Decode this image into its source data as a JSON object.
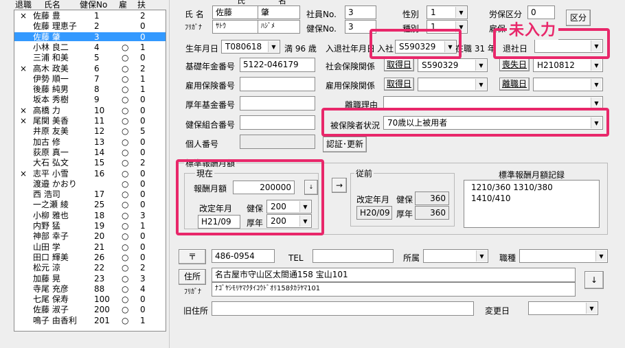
{
  "list": {
    "headers": {
      "retire": "退職",
      "name": "氏名",
      "kenpo_no": "健保No",
      "employment": "雇",
      "dependents": "扶"
    },
    "rows": [
      {
        "retire": "×",
        "name": "佐藤 豊",
        "no": "1",
        "emp": "",
        "dep": "2"
      },
      {
        "retire": "",
        "name": "佐藤 理恵子",
        "no": "2",
        "emp": "",
        "dep": "0"
      },
      {
        "retire": "",
        "name": "佐藤 肇",
        "no": "3",
        "emp": "",
        "dep": "0",
        "selected": true
      },
      {
        "retire": "",
        "name": "小林 良二",
        "no": "4",
        "emp": "○",
        "dep": "1"
      },
      {
        "retire": "",
        "name": "三浦 和美",
        "no": "5",
        "emp": "○",
        "dep": "0"
      },
      {
        "retire": "×",
        "name": "高木 政美",
        "no": "6",
        "emp": "○",
        "dep": "2"
      },
      {
        "retire": "",
        "name": "伊勢 順一",
        "no": "7",
        "emp": "○",
        "dep": "1"
      },
      {
        "retire": "",
        "name": "後藤 純男",
        "no": "8",
        "emp": "○",
        "dep": "1"
      },
      {
        "retire": "",
        "name": "坂本 秀樹",
        "no": "9",
        "emp": "○",
        "dep": "0"
      },
      {
        "retire": "×",
        "name": "高橋 力",
        "no": "10",
        "emp": "○",
        "dep": "0"
      },
      {
        "retire": "×",
        "name": "尾関 美香",
        "no": "11",
        "emp": "○",
        "dep": "0"
      },
      {
        "retire": "",
        "name": "井原 友美",
        "no": "12",
        "emp": "○",
        "dep": "5"
      },
      {
        "retire": "",
        "name": "加古 修",
        "no": "13",
        "emp": "○",
        "dep": "0"
      },
      {
        "retire": "",
        "name": "荻原 真一",
        "no": "14",
        "emp": "○",
        "dep": "0"
      },
      {
        "retire": "",
        "name": "大石 弘文",
        "no": "15",
        "emp": "○",
        "dep": "2"
      },
      {
        "retire": "×",
        "name": "志平 小雪",
        "no": "16",
        "emp": "○",
        "dep": "0"
      },
      {
        "retire": "",
        "name": "渡邉 かおり",
        "no": "",
        "emp": "○",
        "dep": "0"
      },
      {
        "retire": "",
        "name": "西 浩司",
        "no": "17",
        "emp": "○",
        "dep": "0"
      },
      {
        "retire": "",
        "name": "一之瀬 綾",
        "no": "25",
        "emp": "○",
        "dep": "0"
      },
      {
        "retire": "",
        "name": "小柳 雅也",
        "no": "18",
        "emp": "○",
        "dep": "3"
      },
      {
        "retire": "",
        "name": "内野 猛",
        "no": "19",
        "emp": "○",
        "dep": "1"
      },
      {
        "retire": "",
        "name": "神部 幸子",
        "no": "20",
        "emp": "○",
        "dep": "0"
      },
      {
        "retire": "",
        "name": "山田 学",
        "no": "21",
        "emp": "○",
        "dep": "0"
      },
      {
        "retire": "",
        "name": "田口 輝美",
        "no": "26",
        "emp": "○",
        "dep": "0"
      },
      {
        "retire": "",
        "name": "松元 涼",
        "no": "22",
        "emp": "○",
        "dep": "2"
      },
      {
        "retire": "",
        "name": "加藤 晃",
        "no": "23",
        "emp": "○",
        "dep": "3"
      },
      {
        "retire": "",
        "name": "寺尾 充彦",
        "no": "88",
        "emp": "○",
        "dep": "4"
      },
      {
        "retire": "",
        "name": "七尾 保寿",
        "no": "100",
        "emp": "○",
        "dep": "0"
      },
      {
        "retire": "",
        "name": "佐藤 淑子",
        "no": "200",
        "emp": "○",
        "dep": "0"
      },
      {
        "retire": "",
        "name": "鳴子 由香利",
        "no": "201",
        "emp": "○",
        "dep": "1"
      }
    ]
  },
  "form": {
    "name_label": "氏 名",
    "furigana_label": "ﾌﾘｶﾞﾅ",
    "sei_header": "氏",
    "mei_header": "名",
    "sei": "佐藤",
    "mei": "肇",
    "sei_kana": "ｻﾄｳ",
    "mei_kana": "ﾊｼﾞﾒ",
    "employee_no_label": "社員No.",
    "employee_no": "3",
    "kenpo_no_label": "健保No.",
    "kenpo_no": "3",
    "gender_label": "性別",
    "gender": "1",
    "type_label": "種別",
    "type": "1",
    "rouho_label": "労保区分",
    "rouho": "0",
    "koho_label": "雇保",
    "kubun_button": "区分",
    "birthday_label": "生年月日",
    "birthday": "T080618",
    "age": "満 96 歳",
    "hire_retire_label": "入退社年月日",
    "hire_label": "入社",
    "hire_date": "S590329",
    "tenure": "在職 31 年",
    "retire_label": "退社日",
    "retire_date": "",
    "pension_no_label": "基礎年金番号",
    "pension_no": "5122-046179",
    "social_ins_label": "社会保険関係",
    "acquire_button": "取得日",
    "social_acquire_date": "S590329",
    "loss_button": "喪失日",
    "loss_date": "H210812",
    "emp_ins_no_label": "雇用保険番号",
    "emp_ins_no": "",
    "emp_ins_label": "雇用保険関係",
    "emp_acquire_button": "取得日",
    "emp_acquire_date": "",
    "leave_button": "離職日",
    "leave_date": "",
    "welfare_fund_label": "厚年基金番号",
    "welfare_fund_no": "",
    "leave_reason_label": "離職理由",
    "leave_reason": "",
    "union_no_label": "健保組合番号",
    "union_no": "",
    "insured_status_label": "被保険者状況",
    "insured_status": "70歳以上被用者",
    "personal_no_label": "個人番号",
    "personal_no": "",
    "auth_button": "認証･更新",
    "unentered_annotation": "未入力",
    "salary_group_label": "標準報酬月額",
    "current_label": "現在",
    "monthly_pay_label": "報酬月額",
    "monthly_pay": "200000",
    "small_btn": "↓",
    "revise_label": "改定年月",
    "revise_date": "H21/09",
    "kenpo_grade_label": "健保",
    "kenpo_grade": "200",
    "kounen_grade_label": "厚年",
    "kounen_grade": "200",
    "arrow_btn": "→",
    "previous_label": "従前",
    "prev_revise_label": "改定年月",
    "prev_revise_date": "H20/09",
    "prev_kenpo_label": "健保",
    "prev_kenpo": "360",
    "prev_kounen_label": "厚年",
    "prev_kounen": "360",
    "record_title": "標準報酬月額記録",
    "record_text": "1210/360 1310/380 1410/410",
    "postal_button": "〒",
    "postal": "486-0954",
    "tel_label": "TEL",
    "tel": "",
    "dept_label": "所属",
    "dept": "",
    "job_label": "職種",
    "job": "",
    "address_button": "住所",
    "address": "名古屋市守山区太閤通158 宝山101",
    "address_kana_label": "ﾌﾘｶﾞﾅ",
    "address_kana": "ﾅｺﾞﾔｼﾓﾘﾔﾏｸﾀｲｺｳﾄﾞｵﾘ158ﾀｶﾗﾔﾏ101",
    "down_button": "↓",
    "old_address_label": "旧住所",
    "old_address": "",
    "change_date_label": "変更日",
    "change_date": ""
  },
  "colors": {
    "highlight": "#e8276a",
    "selection": "#3399ff"
  }
}
